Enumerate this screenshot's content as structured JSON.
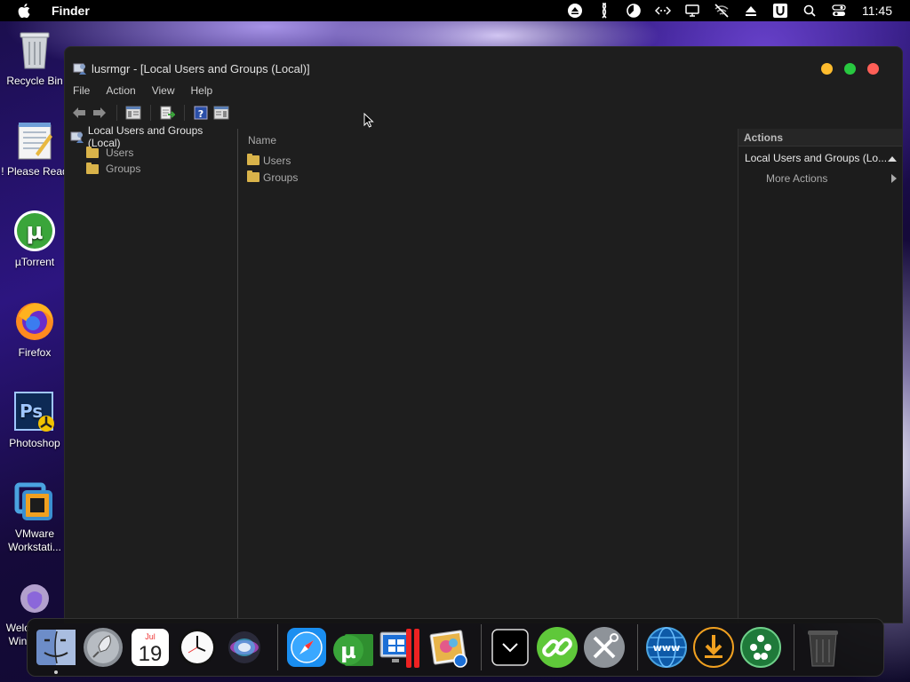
{
  "menubar": {
    "app_name": "Finder",
    "clock": "11:45",
    "status_icons": [
      "eject-icon",
      "script-icon",
      "pie-icon",
      "code-icon",
      "display-icon",
      "wifi-off-icon",
      "upload-icon",
      "u-icon",
      "search-icon",
      "control-center-icon"
    ]
  },
  "desktop": {
    "icons": [
      {
        "label": "Recycle Bin",
        "icon": "recycle-bin-icon"
      },
      {
        "label": "! Please Read",
        "icon": "notepad-icon"
      },
      {
        "label": "µTorrent",
        "icon": "utorrent-icon"
      },
      {
        "label": "Firefox",
        "icon": "firefox-icon"
      },
      {
        "label": "Photoshop",
        "icon": "photoshop-icon"
      },
      {
        "label": "VMware Workstati...",
        "icon": "vmware-icon"
      },
      {
        "label": "Welc Win",
        "icon": "welcome-icon"
      }
    ]
  },
  "window": {
    "title": "lusrmgr - [Local Users and Groups (Local)]",
    "colors": {
      "close": "#ff5f57",
      "minimize": "#febc2e",
      "zoom": "#28c840"
    },
    "menu": [
      "File",
      "Action",
      "View",
      "Help"
    ],
    "tree": {
      "root": "Local Users and Groups (Local)",
      "children": [
        "Users",
        "Groups"
      ]
    },
    "list": {
      "header": "Name",
      "items": [
        "Users",
        "Groups"
      ]
    },
    "actions": {
      "header": "Actions",
      "section": "Local Users and Groups (Lo...",
      "more": "More Actions"
    }
  },
  "dock": {
    "items": [
      "finder-icon",
      "launchpad-icon",
      "calendar-icon",
      "clock-icon",
      "siri-icon",
      "safari-icon",
      "utorrent-icon",
      "parallels-icon",
      "photos-icon",
      "downloads-stack-icon",
      "link-icon",
      "tools-icon",
      "www-icon",
      "download-icon",
      "network-icon",
      "trash-icon"
    ],
    "calendar_month": "Jul",
    "calendar_day": "19"
  }
}
